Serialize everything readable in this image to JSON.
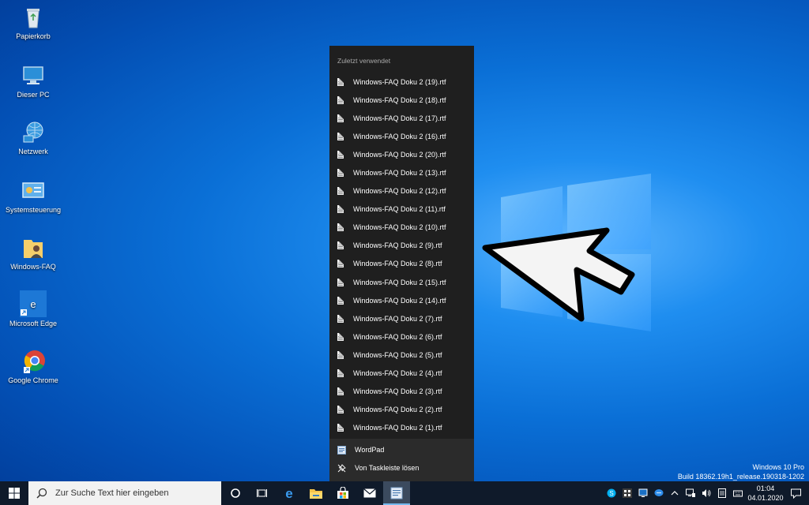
{
  "desktop_icons": [
    {
      "label": "Papierkorb",
      "icon": "recycle-bin-icon"
    },
    {
      "label": "Dieser PC",
      "icon": "computer-icon"
    },
    {
      "label": "Netzwerk",
      "icon": "network-icon"
    },
    {
      "label": "Systemsteuerung",
      "icon": "control-panel-icon"
    },
    {
      "label": "Windows-FAQ",
      "icon": "folder-user-icon"
    },
    {
      "label": "Microsoft Edge",
      "icon": "edge-icon"
    },
    {
      "label": "Google Chrome",
      "icon": "chrome-icon"
    }
  ],
  "jumplist": {
    "header": "Zuletzt verwendet",
    "items": [
      "Windows-FAQ Doku 2 (19).rtf",
      "Windows-FAQ Doku 2 (18).rtf",
      "Windows-FAQ Doku 2 (17).rtf",
      "Windows-FAQ Doku 2 (16).rtf",
      "Windows-FAQ Doku 2 (20).rtf",
      "Windows-FAQ Doku 2 (13).rtf",
      "Windows-FAQ Doku 2 (12).rtf",
      "Windows-FAQ Doku 2 (11).rtf",
      "Windows-FAQ Doku 2 (10).rtf",
      "Windows-FAQ Doku 2 (9).rtf",
      "Windows-FAQ Doku 2 (8).rtf",
      "Windows-FAQ Doku 2 (15).rtf",
      "Windows-FAQ Doku 2 (14).rtf",
      "Windows-FAQ Doku 2 (7).rtf",
      "Windows-FAQ Doku 2 (6).rtf",
      "Windows-FAQ Doku 2 (5).rtf",
      "Windows-FAQ Doku 2 (4).rtf",
      "Windows-FAQ Doku 2 (3).rtf",
      "Windows-FAQ Doku 2 (2).rtf",
      "Windows-FAQ Doku 2 (1).rtf"
    ],
    "app_name": "WordPad",
    "unpin_label": "Von Taskleiste lösen"
  },
  "taskbar": {
    "search_placeholder": "Zur Suche Text hier eingeben",
    "clock_time": "01:04",
    "clock_date": "04.01.2020"
  },
  "watermark": {
    "edition": "Windows 10 Pro",
    "build": "Build 18362.19h1_release.190318-1202"
  },
  "colors": {
    "accent": "#0a6fd6",
    "jumplist_bg": "#1f1f1f",
    "taskbar_bg": "#0f1a2a"
  }
}
